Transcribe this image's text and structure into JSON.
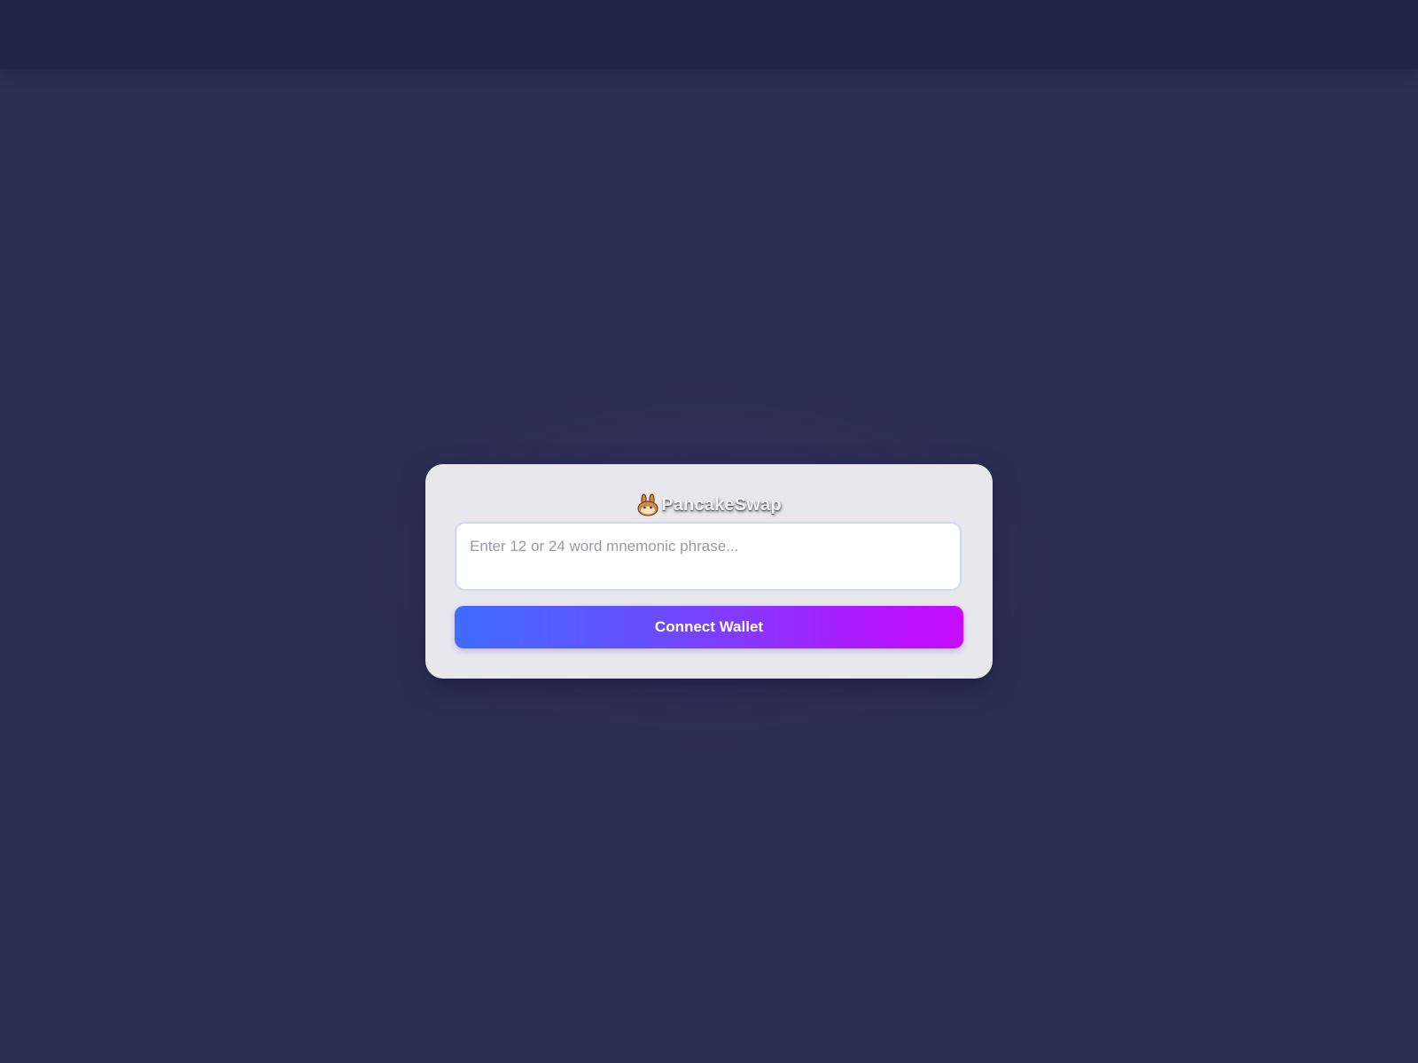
{
  "brand": {
    "name": "PancakeSwap",
    "icon": "bunny-icon"
  },
  "form": {
    "placeholder": "Enter 12 or 24 word mnemonic phrase...",
    "value": "",
    "submit_label": "Connect Wallet"
  },
  "colors": {
    "background": "#2a3050",
    "topbar": "#1f2545",
    "card": "#e8e8ec",
    "button_gradient_start": "#3f6cff",
    "button_gradient_end": "#c70cff"
  }
}
